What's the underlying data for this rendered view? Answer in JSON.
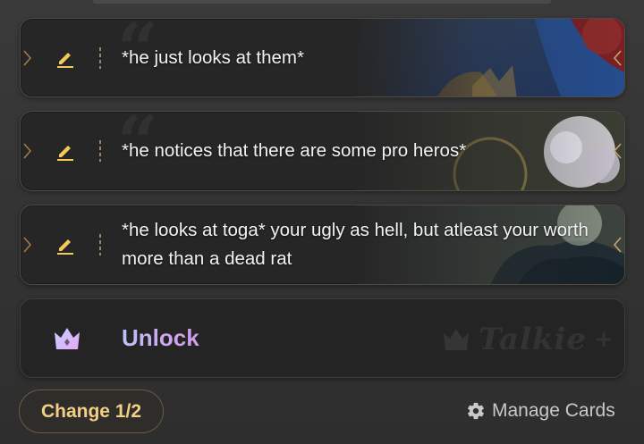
{
  "cards": [
    {
      "text": "*he just looks at them*"
    },
    {
      "text": "*he notices that there are some pro heros*"
    },
    {
      "text": "*he looks at toga* your ugly as hell, but atleast your worth more than a dead rat"
    }
  ],
  "unlock": {
    "label": "Unlock",
    "watermark": "Talkie"
  },
  "footer": {
    "change_label": "Change 1/2",
    "manage_label": "Manage Cards"
  },
  "colors": {
    "accent_gold": "#f3cf85",
    "pencil": "#f5c85a",
    "unlock_gradient_start": "#b9c4f5",
    "unlock_gradient_end": "#d59be8",
    "card_bg": "#262626"
  },
  "icons": {
    "edit": "pencil-icon",
    "unlock": "crown-icon",
    "manage": "gear-icon",
    "card_nav_left": "chevron-left-icon",
    "card_nav_right": "chevron-right-icon"
  }
}
